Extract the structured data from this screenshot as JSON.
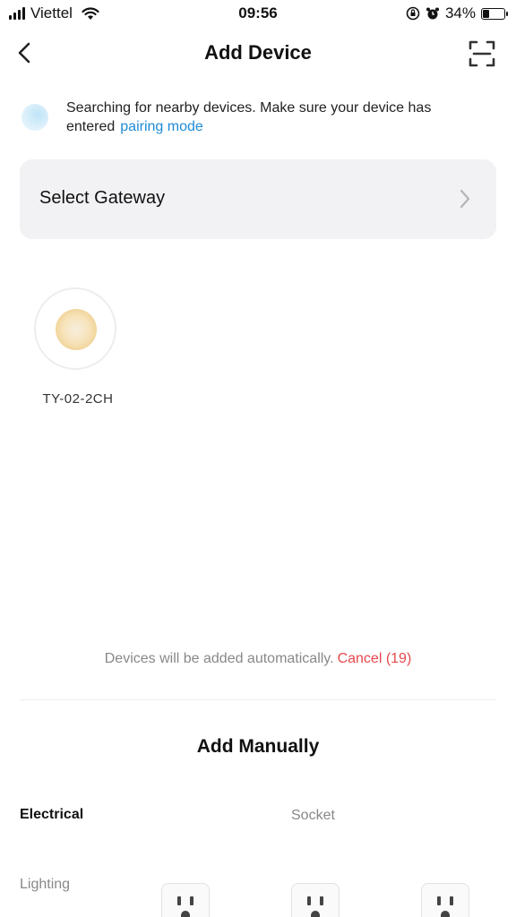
{
  "status_bar": {
    "carrier": "Viettel",
    "time": "09:56",
    "battery_text": "34%",
    "battery_level": 0.34
  },
  "header": {
    "title": "Add Device"
  },
  "searching": {
    "text": "Searching for nearby devices. Make sure your device has entered",
    "link": "pairing mode"
  },
  "gateway": {
    "label": "Select Gateway"
  },
  "found_devices": [
    {
      "name": "TY-02-2CH"
    }
  ],
  "auto_add": {
    "text": "Devices will be added automatically.",
    "cancel": "Cancel (19)"
  },
  "manual": {
    "title": "Add Manually",
    "categories": [
      {
        "label": "Electrical",
        "selected": true
      },
      {
        "label": "Lighting",
        "selected": false
      }
    ],
    "subcategory": "Socket"
  },
  "colors": {
    "link": "#1e8bd6",
    "cancel": "#e5484d",
    "card_bg": "#f2f2f4"
  }
}
